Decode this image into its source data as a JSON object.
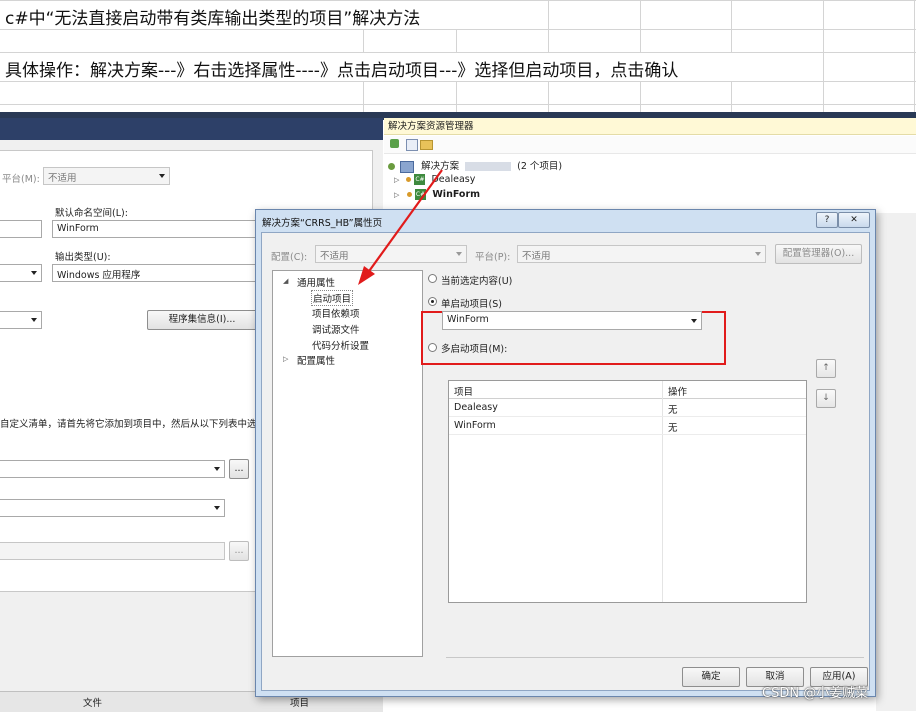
{
  "sheet": {
    "row1_text": "c#中“无法直接启动带有类库输出类型的项目”解决方法",
    "row2_text": "具体操作：解决方案---》右击选择属性----》点击启动项目---》选择但启动项目，点击确认"
  },
  "project_props": {
    "platform_label": "平台(M):",
    "platform_value": "不适用",
    "namespace_label": "默认命名空间(L):",
    "namespace_value": "WinForm",
    "output_type_label": "输出类型(U):",
    "output_type_value": "Windows 应用程序",
    "assembly_info_button": "程序集信息(I)...",
    "manifest_text": "自定义清单，请首先将它添加到项目中，然后从以下列表中选择",
    "ellipsis": "...",
    "bottom_tabs": [
      "文件",
      "项目"
    ]
  },
  "solution_explorer": {
    "title": "解决方案资源管理器",
    "solution_label": "解决方案",
    "solution_suffix": "(2 个项目)",
    "projects": [
      "Dealeasy",
      "WinForm"
    ]
  },
  "dialog": {
    "title": "解决方案“CRRS_HB”属性页",
    "help": "?",
    "close": "✕",
    "config_label": "配置(C):",
    "config_value": "不适用",
    "platform_label": "平台(P):",
    "platform_value": "不适用",
    "config_manager_button": "配置管理器(O)...",
    "tree": {
      "common": "通用属性",
      "items": [
        "启动项目",
        "项目依赖项",
        "调试源文件",
        "代码分析设置"
      ],
      "config": "配置属性"
    },
    "radio_current": "当前选定内容(U)",
    "radio_single": "单启动项目(S)",
    "single_value": "WinForm",
    "radio_multi": "多启动项目(M):",
    "grid_headers": [
      "项目",
      "操作"
    ],
    "grid_rows": [
      {
        "project": "Dealeasy",
        "action": "无"
      },
      {
        "project": "WinForm",
        "action": "无"
      }
    ],
    "up_button": "↑",
    "down_button": "↓",
    "ok_button": "确定",
    "cancel_button": "取消",
    "apply_button": "应用(A)"
  },
  "watermark": "CSDN @小姜贼菜",
  "colors": {
    "highlight_box": "#e11b1b",
    "arrow": "#e11b1b",
    "vs_title": "#293955",
    "explorer_title": "#fff9d6"
  }
}
